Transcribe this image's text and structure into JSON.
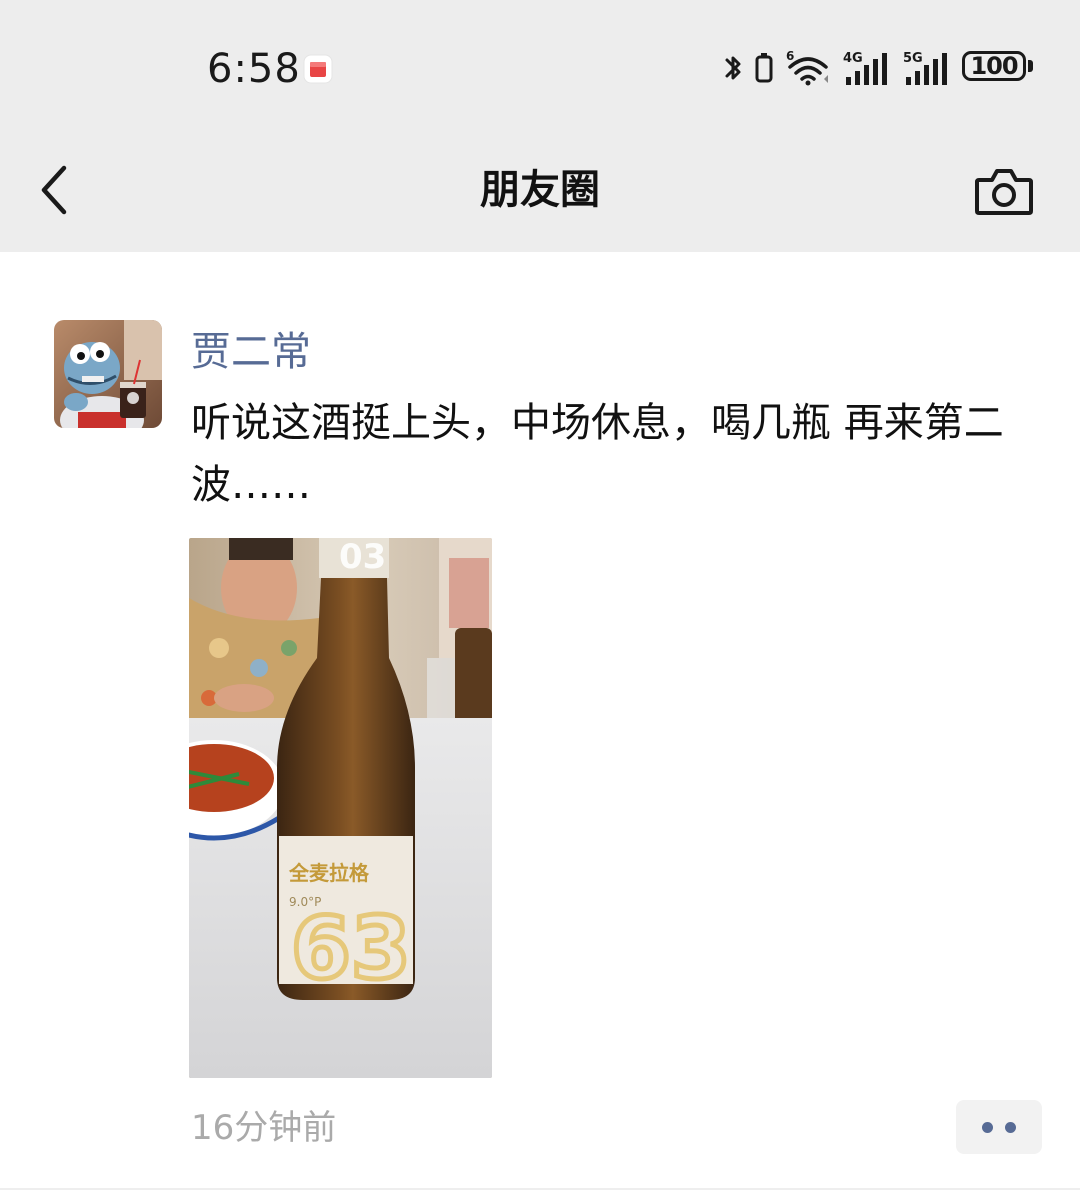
{
  "status_bar": {
    "time": "6:58",
    "battery_level": "100",
    "network_labels": [
      "4G",
      "5G"
    ],
    "wifi_label": "6",
    "icons": [
      "app-notification-icon",
      "bluetooth-icon",
      "vibrate-icon",
      "wifi-icon",
      "cellular-signal-icon",
      "battery-icon"
    ]
  },
  "nav": {
    "title": "朋友圈",
    "back_icon": "chevron-left-icon",
    "camera_icon": "camera-icon"
  },
  "post": {
    "author": "贾二常",
    "text": "听说这酒挺上头，中场休息，喝几瓶 再来第二波……",
    "time": "16分钟前",
    "image_label": "全麦拉格",
    "image_sublabel": "9.0°P",
    "image_number": "63",
    "more_icon": "more-dots-icon"
  },
  "colors": {
    "header_bg": "#ededed",
    "name_color": "#576b95",
    "time_color": "#aaaaaa",
    "page_bg": "#ffffff"
  }
}
